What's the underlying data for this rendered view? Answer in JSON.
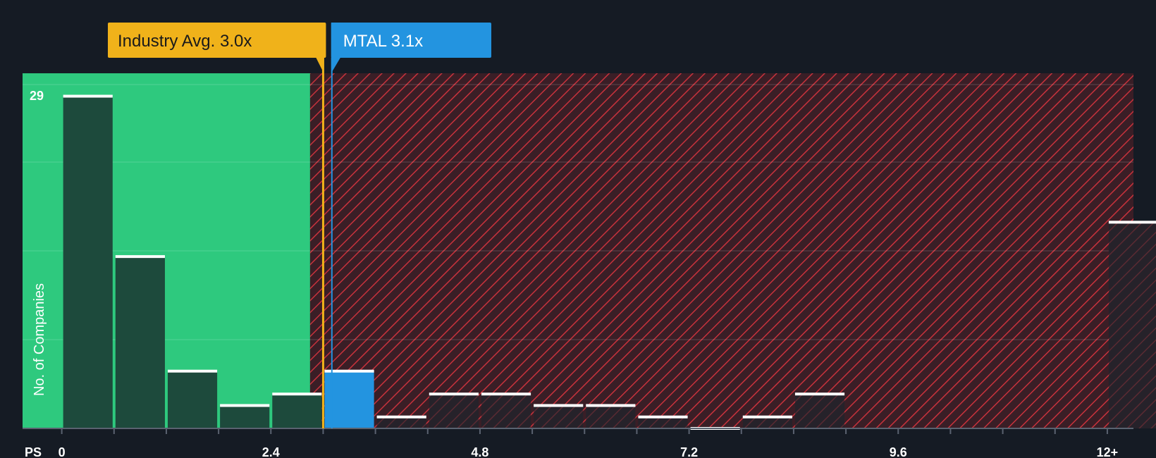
{
  "chart_data": {
    "type": "bar",
    "title": "",
    "xlabel": "PS",
    "ylabel": "No. of Companies",
    "bin_width": 0.6,
    "x_ticks": [
      {
        "value": 0,
        "label": "0"
      },
      {
        "value": 2.4,
        "label": "2.4"
      },
      {
        "value": 4.8,
        "label": "4.8"
      },
      {
        "value": 7.2,
        "label": "7.2"
      },
      {
        "value": 9.6,
        "label": "9.6"
      },
      {
        "value": 12,
        "label": "12+"
      }
    ],
    "xlim": [
      -0.45,
      12.3
    ],
    "ylim": [
      0,
      31
    ],
    "y_max_label": "29",
    "bars": [
      {
        "x0": 0.0,
        "count": 29,
        "zone": "green"
      },
      {
        "x0": 0.6,
        "count": 15,
        "zone": "green"
      },
      {
        "x0": 1.2,
        "count": 5,
        "zone": "green"
      },
      {
        "x0": 1.8,
        "count": 2,
        "zone": "green"
      },
      {
        "x0": 2.4,
        "count": 3,
        "zone": "green"
      },
      {
        "x0": 3.0,
        "count": 5,
        "zone": "highlight"
      },
      {
        "x0": 3.6,
        "count": 1,
        "zone": "red"
      },
      {
        "x0": 4.2,
        "count": 3,
        "zone": "red"
      },
      {
        "x0": 4.8,
        "count": 3,
        "zone": "red"
      },
      {
        "x0": 5.4,
        "count": 2,
        "zone": "red"
      },
      {
        "x0": 6.0,
        "count": 2,
        "zone": "red"
      },
      {
        "x0": 6.6,
        "count": 1,
        "zone": "red"
      },
      {
        "x0": 7.2,
        "count": 0,
        "zone": "red"
      },
      {
        "x0": 7.8,
        "count": 1,
        "zone": "red"
      },
      {
        "x0": 8.4,
        "count": 3,
        "zone": "red"
      },
      {
        "x0": 12.0,
        "count": 18,
        "zone": "red"
      }
    ],
    "green_zone_end": 2.85,
    "industry_avg": {
      "value": 3.0,
      "label": "Industry Avg. 3.0x"
    },
    "company": {
      "value": 3.1,
      "label": "MTAL 3.1x"
    },
    "colors": {
      "background": "#151b24",
      "green_zone": "#2ec97e",
      "green_bar": "#1d4a3c",
      "red_zone": "#3a1e26",
      "red_hatch": "#c8323c",
      "red_bar": "#2a2228",
      "highlight_bar": "#2394e0",
      "industry": "#f0b21a",
      "company": "#2394e0",
      "bar_cap": "#ffffff",
      "axis": "#5a6270"
    }
  }
}
